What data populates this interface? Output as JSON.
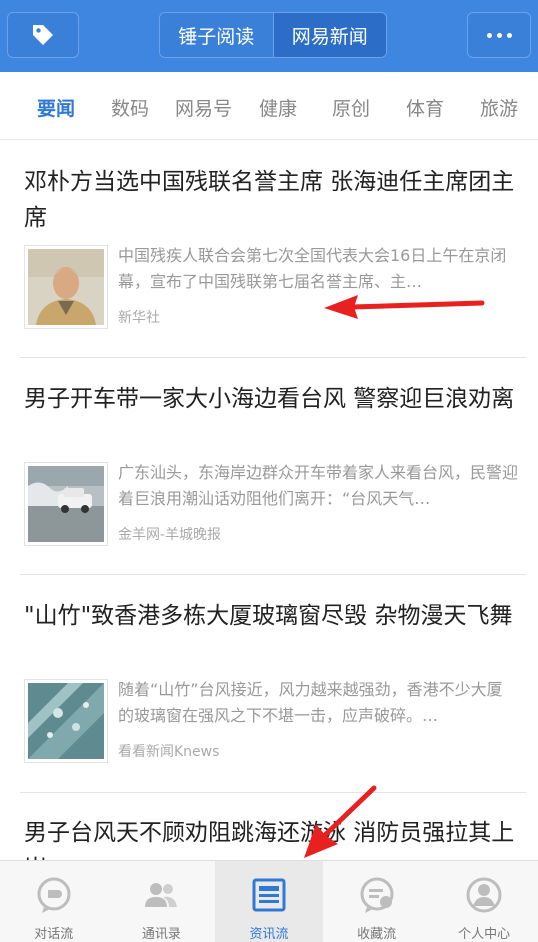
{
  "topbar": {
    "left_icon": "tag-icon",
    "segments": [
      {
        "label": "锤子阅读",
        "active": false
      },
      {
        "label": "网易新闻",
        "active": true
      }
    ],
    "right_icon": "more-icon"
  },
  "categories": [
    {
      "label": "要闻",
      "active": true
    },
    {
      "label": "数码",
      "active": false
    },
    {
      "label": "网易号",
      "active": false
    },
    {
      "label": "健康",
      "active": false
    },
    {
      "label": "原创",
      "active": false
    },
    {
      "label": "体育",
      "active": false
    },
    {
      "label": "旅游",
      "active": false
    }
  ],
  "articles": [
    {
      "title": "邓朴方当选中国残联名誉主席 张海迪任主席团主席",
      "desc": "中国残疾人联合会第七次全国代表大会16日上午在京闭幕，宣布了中国残联第七届名誉主席、主…",
      "source": "新华社",
      "thumb_icon": "portrait-photo"
    },
    {
      "title": "男子开车带一家大小海边看台风 警察迎巨浪劝离",
      "desc": "广东汕头，东海岸边群众开车带着家人来看台风，民警迎着巨浪用潮汕话劝阻他们离开：“台风天气…",
      "source": "金羊网-羊城晚报",
      "thumb_icon": "car-waves-photo"
    },
    {
      "title": "\"山竹\"致香港多栋大厦玻璃窗尽毁 杂物漫天飞舞",
      "desc": "随着“山竹”台风接近，风力越来越强劲，香港不少大厦的玻璃窗在强风之下不堪一击，应声破碎。…",
      "source": "看看新闻Knews",
      "thumb_icon": "broken-glass-photo"
    },
    {
      "title": "男子台风天不顾劝阻跳海还游泳 消防员强拉其上岸",
      "desc": "",
      "source": "",
      "thumb_icon": ""
    }
  ],
  "bottom_nav": [
    {
      "label": "对话流",
      "icon": "chat-bubble-icon",
      "active": false
    },
    {
      "label": "通讯录",
      "icon": "contacts-icon",
      "active": false
    },
    {
      "label": "资讯流",
      "icon": "news-feed-icon",
      "active": true
    },
    {
      "label": "收藏流",
      "icon": "favorites-icon",
      "active": false
    },
    {
      "label": "个人中心",
      "icon": "profile-icon",
      "active": false
    }
  ],
  "colors": {
    "brand_blue": "#3e86e0",
    "active_tab": "#2f78d6",
    "annotation_red": "#e8201f"
  }
}
